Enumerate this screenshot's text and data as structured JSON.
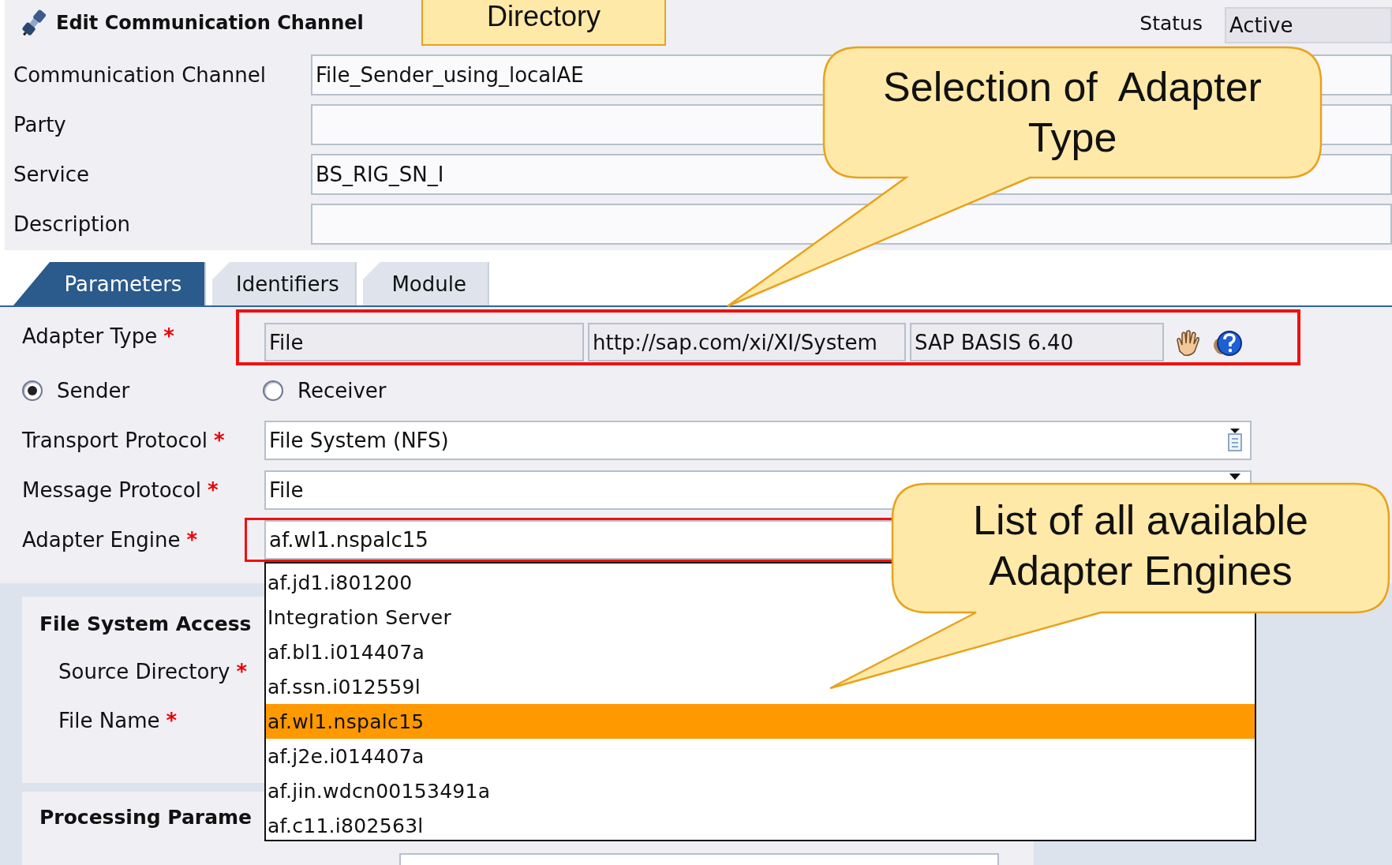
{
  "window": {
    "title": "Edit Communication Channel"
  },
  "status": {
    "label": "Status",
    "value": "Active"
  },
  "header_fields": [
    {
      "label": "Communication Channel",
      "value": "File_Sender_using_localAE"
    },
    {
      "label": "Party"
    },
    {
      "label": "Service",
      "value": "BS_RIG_SN_I"
    },
    {
      "label": "Description"
    }
  ],
  "tabs": [
    {
      "label": "Parameters",
      "selected": true
    },
    {
      "label": "Identifiers",
      "selected": false
    },
    {
      "label": "Module",
      "selected": false
    }
  ],
  "adapter_type": {
    "label": "Adapter Type",
    "marker": "*",
    "highlighted": true,
    "values": [
      "File",
      "http://sap.com/xi/XI/System",
      "SAP BASIS 6.40"
    ]
  },
  "direction": [
    {
      "label": "Sender",
      "selected": true
    },
    {
      "label": "Receiver",
      "selected": false
    }
  ],
  "protocol_fields": [
    {
      "label": "Transport Protocol",
      "marker": "*",
      "value": "File System (NFS)",
      "kind": "valuehelp",
      "highlighted": false
    },
    {
      "label": "Message Protocol",
      "marker": "*",
      "value": "File",
      "kind": "dropdown",
      "highlighted": false
    },
    {
      "label": "Adapter Engine",
      "marker": "*",
      "value": "af.wl1.nspalc15",
      "kind": "dropdown",
      "highlighted": true
    }
  ],
  "dropdown": {
    "options": [
      {
        "label": "af.jd1.i801200",
        "selected": false
      },
      {
        "label": "Integration Server",
        "selected": false
      },
      {
        "label": "af.bl1.i014407a",
        "selected": false
      },
      {
        "label": "af.ssn.i012559l",
        "selected": false
      },
      {
        "label": "af.wl1.nspalc15",
        "selected": true
      },
      {
        "label": "af.j2e.i014407a",
        "selected": false
      },
      {
        "label": "af.jin.wdcn00153491a",
        "selected": false
      },
      {
        "label": "af.c11.i802563l",
        "selected": false
      }
    ]
  },
  "sections": [
    {
      "title": "File System Access",
      "fields": [
        {
          "label": "Source Directory",
          "marker": "*"
        },
        {
          "label": "File Name",
          "marker": "*"
        }
      ]
    },
    {
      "title": "Processing Parame"
    }
  ],
  "callouts": [
    {
      "kind": "box",
      "text": "Directory"
    },
    {
      "kind": "speech",
      "text": "Selection of  Adapter Type"
    },
    {
      "kind": "speech",
      "text": "List of all available Adapter Engines"
    }
  ]
}
